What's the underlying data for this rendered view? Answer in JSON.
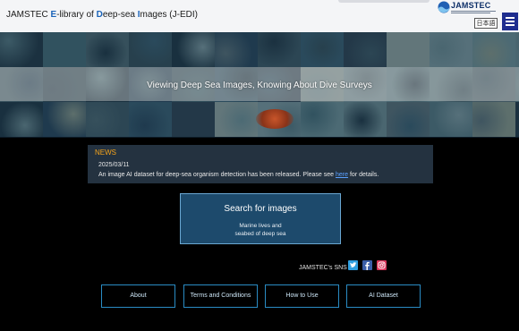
{
  "header": {
    "title_parts": [
      {
        "text": "JAMSTEC ",
        "accent": false
      },
      {
        "text": "E",
        "accent": true
      },
      {
        "text": "-library of ",
        "accent": false
      },
      {
        "text": "D",
        "accent": true
      },
      {
        "text": "eep-sea ",
        "accent": false
      },
      {
        "text": "I",
        "accent": true
      },
      {
        "text": "mages (J-EDI)",
        "accent": false
      }
    ],
    "logo_text": "JAMSTEC",
    "language_button": "日本語",
    "menu_icon": "hamburger-icon"
  },
  "hero": {
    "caption": "Viewing Deep Sea Images, Knowing About Dive Surveys"
  },
  "news": {
    "heading": "NEWS",
    "date": "2025/03/11",
    "text_before_link": "An image AI dataset for deep-sea organism detection has been released. Please see ",
    "link_text": "here",
    "text_after_link": " for details."
  },
  "search": {
    "title": "Search for images",
    "subtitle_line1": "Marine lives and",
    "subtitle_line2": "seabed of deep sea"
  },
  "sns": {
    "label": "JAMSTEC's SNS",
    "icons": [
      "twitter-icon",
      "facebook-icon",
      "instagram-icon"
    ]
  },
  "nav": {
    "about": "About",
    "terms": "Terms and Conditions",
    "how_to_use": "How to Use",
    "ai_dataset": "AI Dataset"
  },
  "colors": {
    "header_bg": "#f4f5f7",
    "accent_blue": "#1a63b8",
    "news_heading": "#f4a31b",
    "search_bg": "#1d4a6c",
    "nav_border": "#2a8cc4"
  }
}
